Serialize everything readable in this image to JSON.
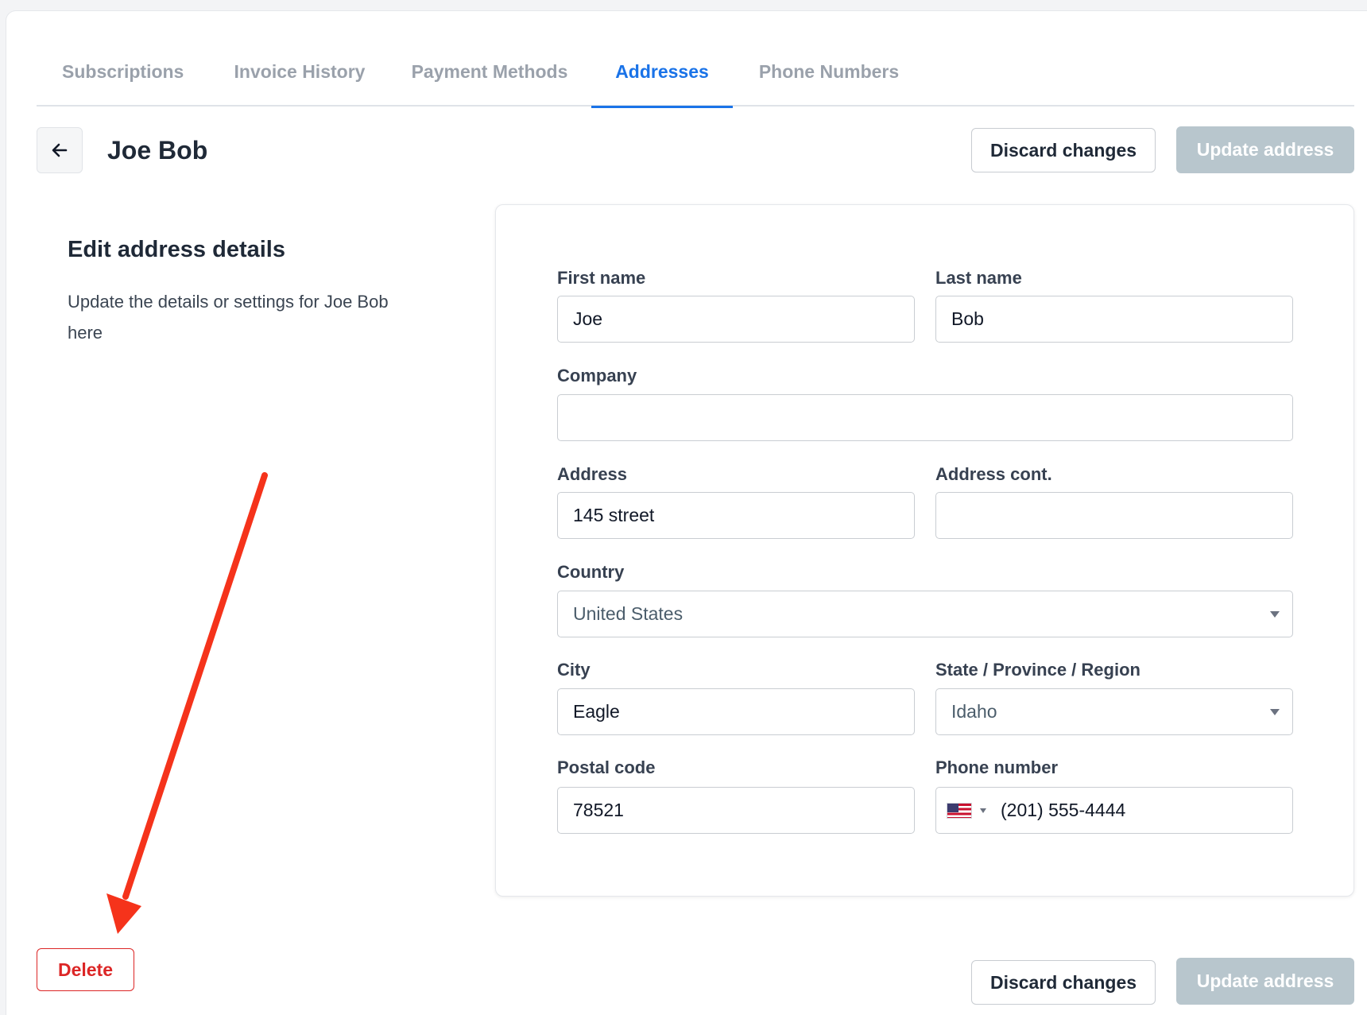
{
  "tabs": [
    {
      "label": "Subscriptions"
    },
    {
      "label": "Invoice History"
    },
    {
      "label": "Payment Methods"
    },
    {
      "label": "Addresses",
      "active": true
    },
    {
      "label": "Phone Numbers"
    }
  ],
  "header": {
    "title": "Joe Bob",
    "discard_label": "Discard changes",
    "update_label": "Update address"
  },
  "intro": {
    "title": "Edit address details",
    "description": "Update the details or settings for Joe Bob here"
  },
  "form": {
    "first_name": {
      "label": "First name",
      "value": "Joe"
    },
    "last_name": {
      "label": "Last name",
      "value": "Bob"
    },
    "company": {
      "label": "Company",
      "value": ""
    },
    "address": {
      "label": "Address",
      "value": "145 street"
    },
    "address_cont": {
      "label": "Address cont.",
      "value": ""
    },
    "country": {
      "label": "Country",
      "value": "United States"
    },
    "city": {
      "label": "City",
      "value": "Eagle"
    },
    "state": {
      "label": "State / Province / Region",
      "value": "Idaho"
    },
    "postal_code": {
      "label": "Postal code",
      "value": "78521"
    },
    "phone": {
      "label": "Phone number",
      "value": "(201) 555-4444",
      "country_flag": "us-flag-icon"
    }
  },
  "footer": {
    "delete_label": "Delete",
    "discard_label": "Discard changes",
    "update_label": "Update address"
  },
  "colors": {
    "accent": "#1a73e8",
    "danger": "#dc2626",
    "disabled_button": "#b8c6cd",
    "annotation_arrow": "#f5331b"
  }
}
